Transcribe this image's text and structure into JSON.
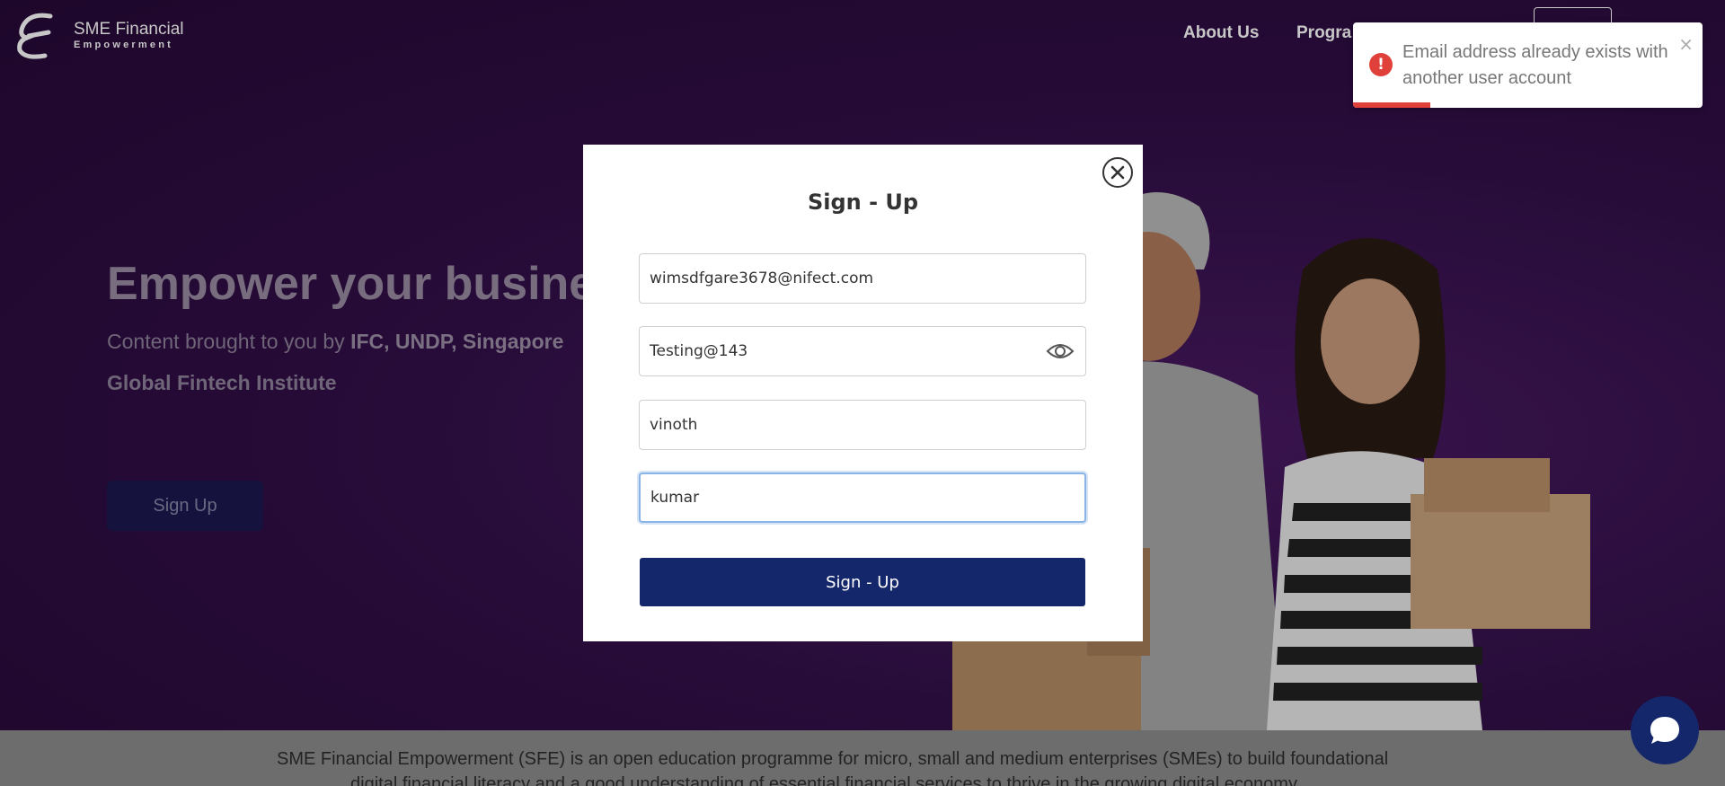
{
  "header": {
    "logo_line1": "SME Financial",
    "logo_line2": "Empowerment",
    "nav": {
      "about": "About Us",
      "programmes": "Progra"
    }
  },
  "hero": {
    "title": "Empower your busine",
    "subtitle_prefix": "Content brought to you by ",
    "subtitle_bold": "IFC, UNDP, Singapore",
    "subtitle_line2": "Global Fintech Institute",
    "cta_label": "Sign Up"
  },
  "about": {
    "line1": "SME Financial Empowerment (SFE) is an open education programme for micro, small and medium enterprises (SMEs) to build foundational",
    "line2": "digital financial literacy and a good understanding of essential financial services to thrive in the growing digital economy."
  },
  "modal": {
    "title": "Sign - Up",
    "fields": {
      "email": "wimsdfgare3678@nifect.com",
      "password": "Testing@143",
      "first_name": "vinoth",
      "last_name": "kumar"
    },
    "submit_label": "Sign - Up"
  },
  "toast": {
    "message": "Email address already exists with another user account",
    "icon": "!",
    "close": "×",
    "status_color": "#e0403a",
    "progress": 0.22
  },
  "colors": {
    "primary": "#15276b",
    "hero_bg": "#33104a"
  }
}
